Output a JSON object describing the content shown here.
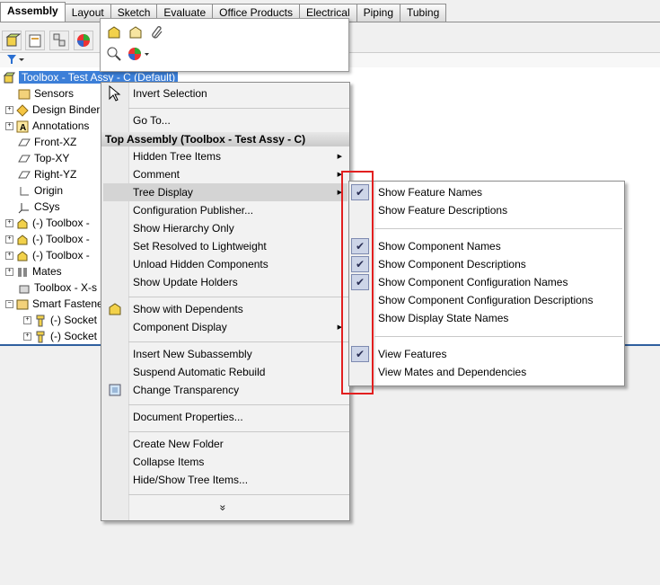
{
  "tabs": [
    "Assembly",
    "Layout",
    "Sketch",
    "Evaluate",
    "Office Products",
    "Electrical",
    "Piping",
    "Tubing"
  ],
  "tree": {
    "root": "Toolbox - Test Assy - C  (Default)",
    "items": [
      "Sensors",
      "Design Binder",
      "Annotations",
      "Front-XZ",
      "Top-XY",
      "Right-YZ",
      "Origin",
      "CSys",
      "(-) Toolbox -",
      "(-) Toolbox -",
      "(-) Toolbox -",
      "Mates",
      "Toolbox - X-s",
      "Smart Fastene",
      "(-) Socket",
      "(-) Socket"
    ]
  },
  "menu": {
    "items_top": [
      "Invert Selection",
      "Go To..."
    ],
    "header": "Top Assembly (Toolbox - Test Assy - C)",
    "items_group1": [
      "Hidden Tree Items",
      "Comment",
      "Tree Display",
      "Configuration Publisher...",
      "Show Hierarchy Only",
      "Set Resolved to Lightweight",
      "Unload Hidden Components",
      "Show Update Holders"
    ],
    "items_group2": [
      "Show with Dependents",
      "Component Display"
    ],
    "items_group3": [
      "Insert New Subassembly",
      "Suspend Automatic Rebuild",
      "Change Transparency"
    ],
    "items_group4": [
      "Document Properties..."
    ],
    "items_group5": [
      "Create New Folder",
      "Collapse Items",
      "Hide/Show Tree Items..."
    ],
    "more": "»"
  },
  "submenu": {
    "items": [
      {
        "label": "Show Feature Names",
        "checked": true
      },
      {
        "label": "Show Feature Descriptions",
        "checked": false
      },
      {
        "label": "Show Component Names",
        "checked": true
      },
      {
        "label": "Show Component Descriptions",
        "checked": true
      },
      {
        "label": "Show Component Configuration Names",
        "checked": true
      },
      {
        "label": "Show Component Configuration Descriptions",
        "checked": false
      },
      {
        "label": "Show Display State Names",
        "checked": false
      },
      {
        "label": "View Features",
        "checked": true
      },
      {
        "label": "View Mates and Dependencies",
        "checked": false
      }
    ]
  },
  "colors": {
    "highlight_box": "#e21f1f",
    "selection": "#3c7fd8"
  }
}
